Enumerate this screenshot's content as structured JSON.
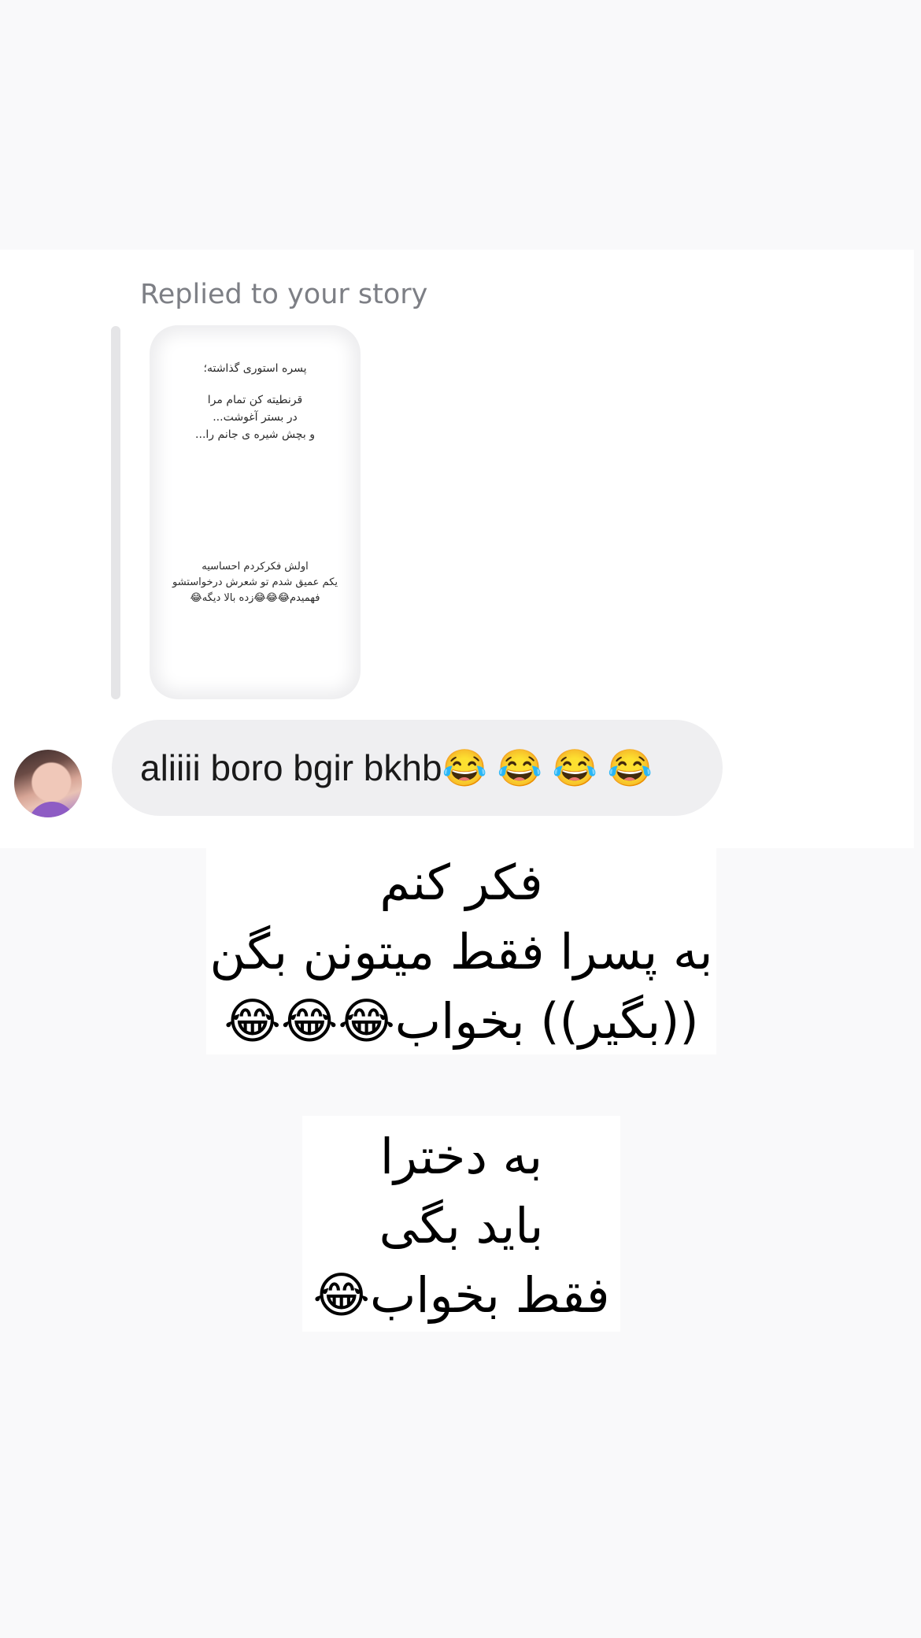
{
  "reply": {
    "label": "Replied to your story"
  },
  "story": {
    "top_lines": [
      "پسره استوری گذاشته؛",
      "قرنطیته کن تمام مرا",
      "در بستر آغوشت...",
      "و بچش شیره ی جانم را..."
    ],
    "bottom_lines": [
      "اولش فکرکردم احساسیه",
      "یکم عمیق شدم تو شعرش درخواستشو",
      "فهمیدم😂😂😂زده بالا دیگه😂"
    ]
  },
  "message": {
    "text": "aliiii boro bgir bkhb😂 😂 😂 😂"
  },
  "caption_1": {
    "lines": [
      "فکر کنم",
      "به پسرا فقط میتونن بگن",
      "((بگیر)) بخواب😂😂😂"
    ]
  },
  "caption_2": {
    "lines": [
      "به دخترا",
      "باید بگی",
      "فقط بخواب😂"
    ]
  },
  "colors": {
    "page_bg": "#f9f9fa",
    "card_bg": "#ffffff",
    "bubble_bg": "#efeff1",
    "label_gray": "#7d7f85",
    "reply_bar": "#e5e5e7"
  }
}
